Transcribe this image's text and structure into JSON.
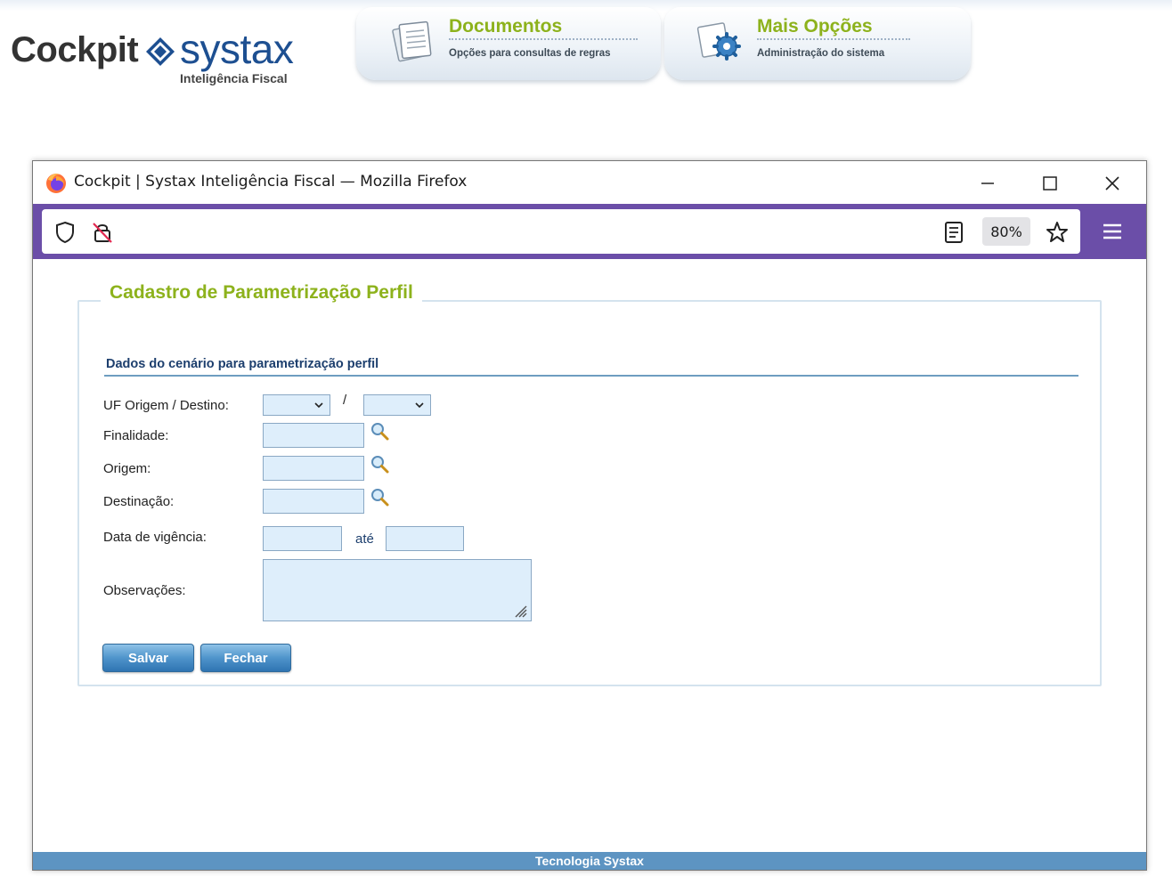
{
  "app": {
    "logo_main": "Cockpit",
    "logo_brand": "systax",
    "logo_sub": "Inteligência Fiscal",
    "nav": [
      {
        "title": "Documentos",
        "subtitle": "Opções para consultas de regras",
        "icon": "documents-icon"
      },
      {
        "title": "Mais Opções",
        "subtitle": "Administração do sistema",
        "icon": "settings-gear-icon"
      }
    ]
  },
  "browser": {
    "window_title": "Cockpit | Systax Inteligência Fiscal — Mozilla Firefox",
    "url": "",
    "zoom": "80%",
    "colors": {
      "toolbar": "#6b4ea8"
    }
  },
  "form": {
    "legend": "Cadastro de Parametrização Perfil",
    "section_title": "Dados do cenário para parametrização perfil",
    "labels": {
      "uf": "UF Origem / Destino:",
      "finalidade": "Finalidade:",
      "origem": "Origem:",
      "destinacao": "Destinação:",
      "vigencia": "Data de vigência:",
      "observacoes": "Observações:"
    },
    "separator_slash": "/",
    "separator_ate": "até",
    "values": {
      "uf_origem": "",
      "uf_destino": "",
      "finalidade": "",
      "origem": "",
      "destinacao": "",
      "vigencia_inicio": "",
      "vigencia_fim": "",
      "observacoes": ""
    },
    "buttons": {
      "save": "Salvar",
      "close": "Fechar"
    },
    "colors": {
      "legend": "#8db21c",
      "button": "#4f94cb",
      "input_bg": "#deeefb"
    }
  },
  "footer": {
    "text": "Tecnologia Systax"
  }
}
